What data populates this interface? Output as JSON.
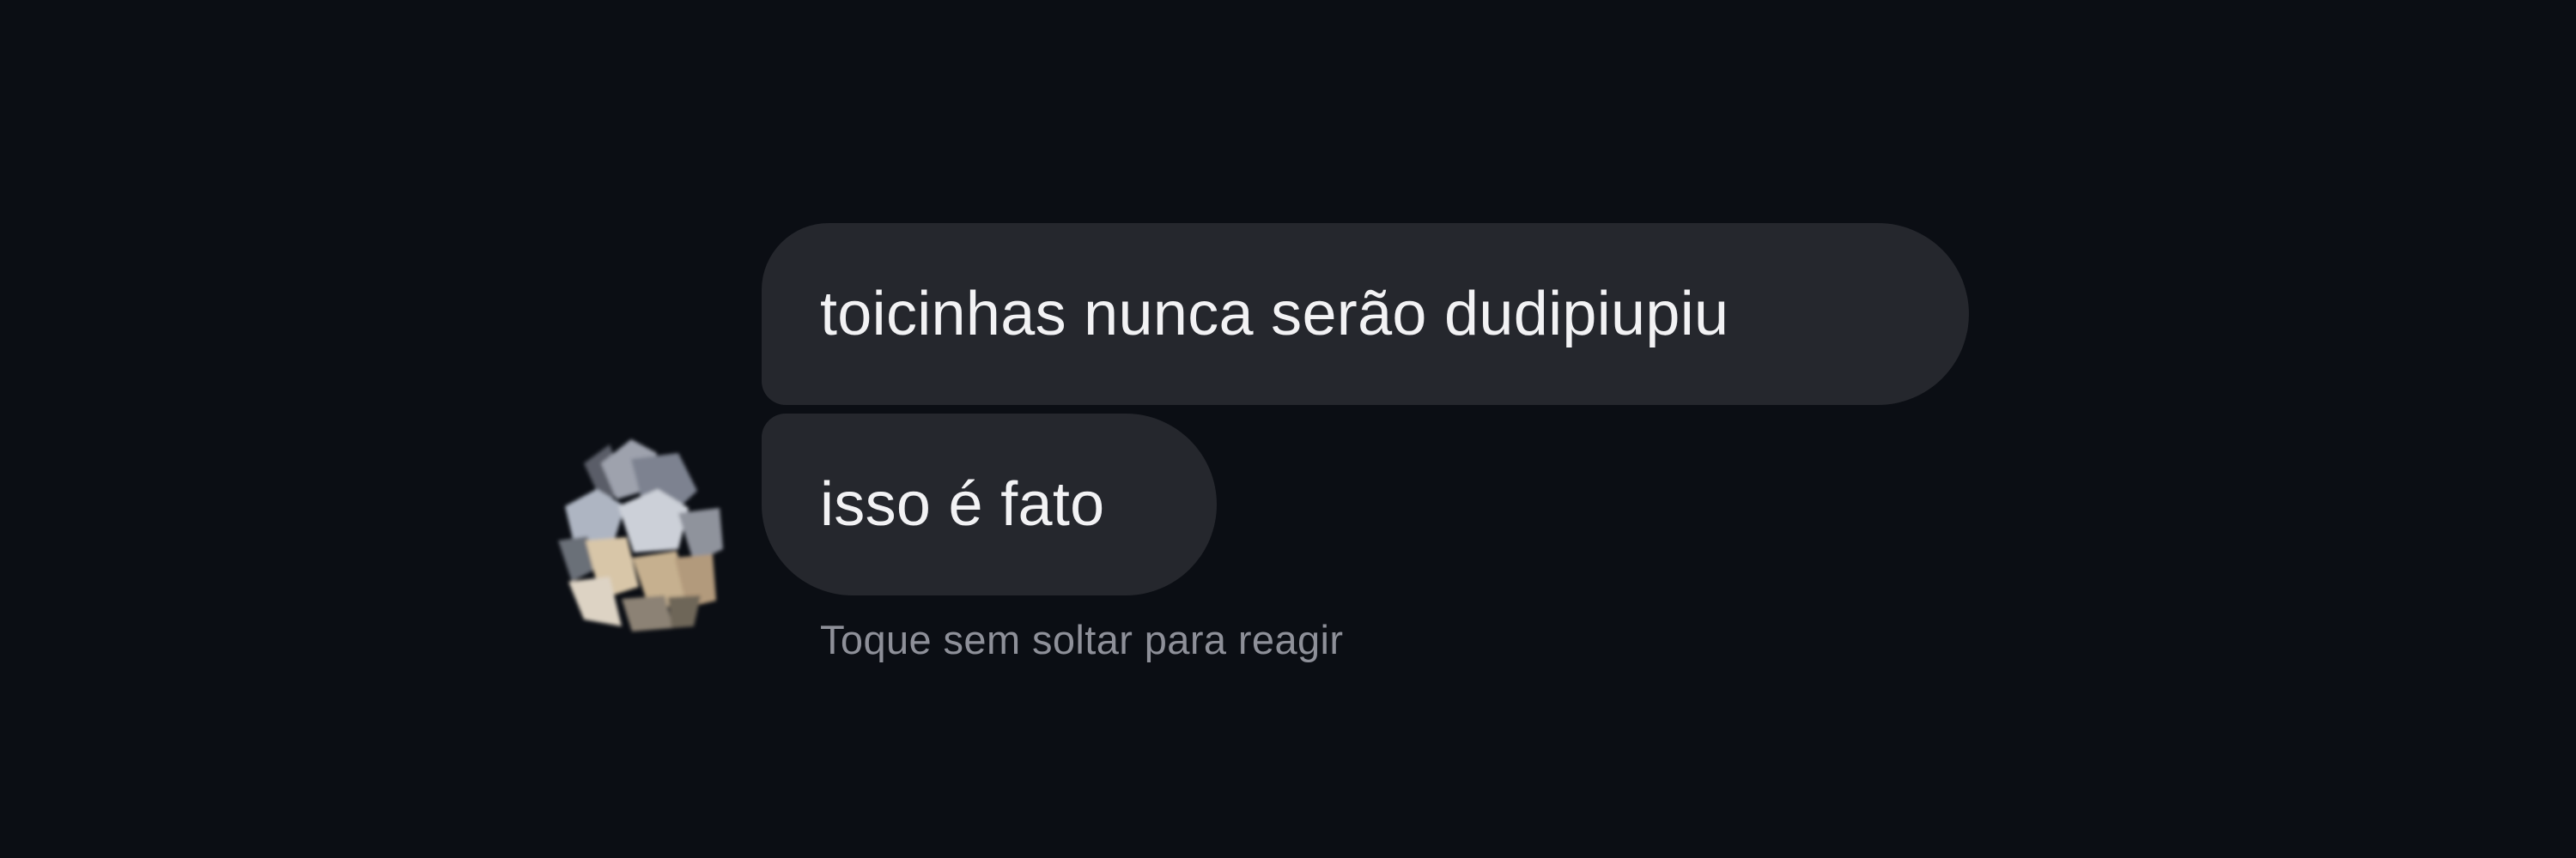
{
  "chat": {
    "messages": [
      {
        "text": "toicinhas nunca serão dudipiupiu"
      },
      {
        "text": "isso é fato"
      }
    ],
    "hint": "Toque sem soltar para reagir"
  },
  "colors": {
    "background": "#0b0e14",
    "bubble": "#25272d",
    "message_text": "#f2f2f4",
    "hint_text": "#8e9099"
  },
  "icons": {
    "avatar": "blurred-avatar-icon"
  }
}
